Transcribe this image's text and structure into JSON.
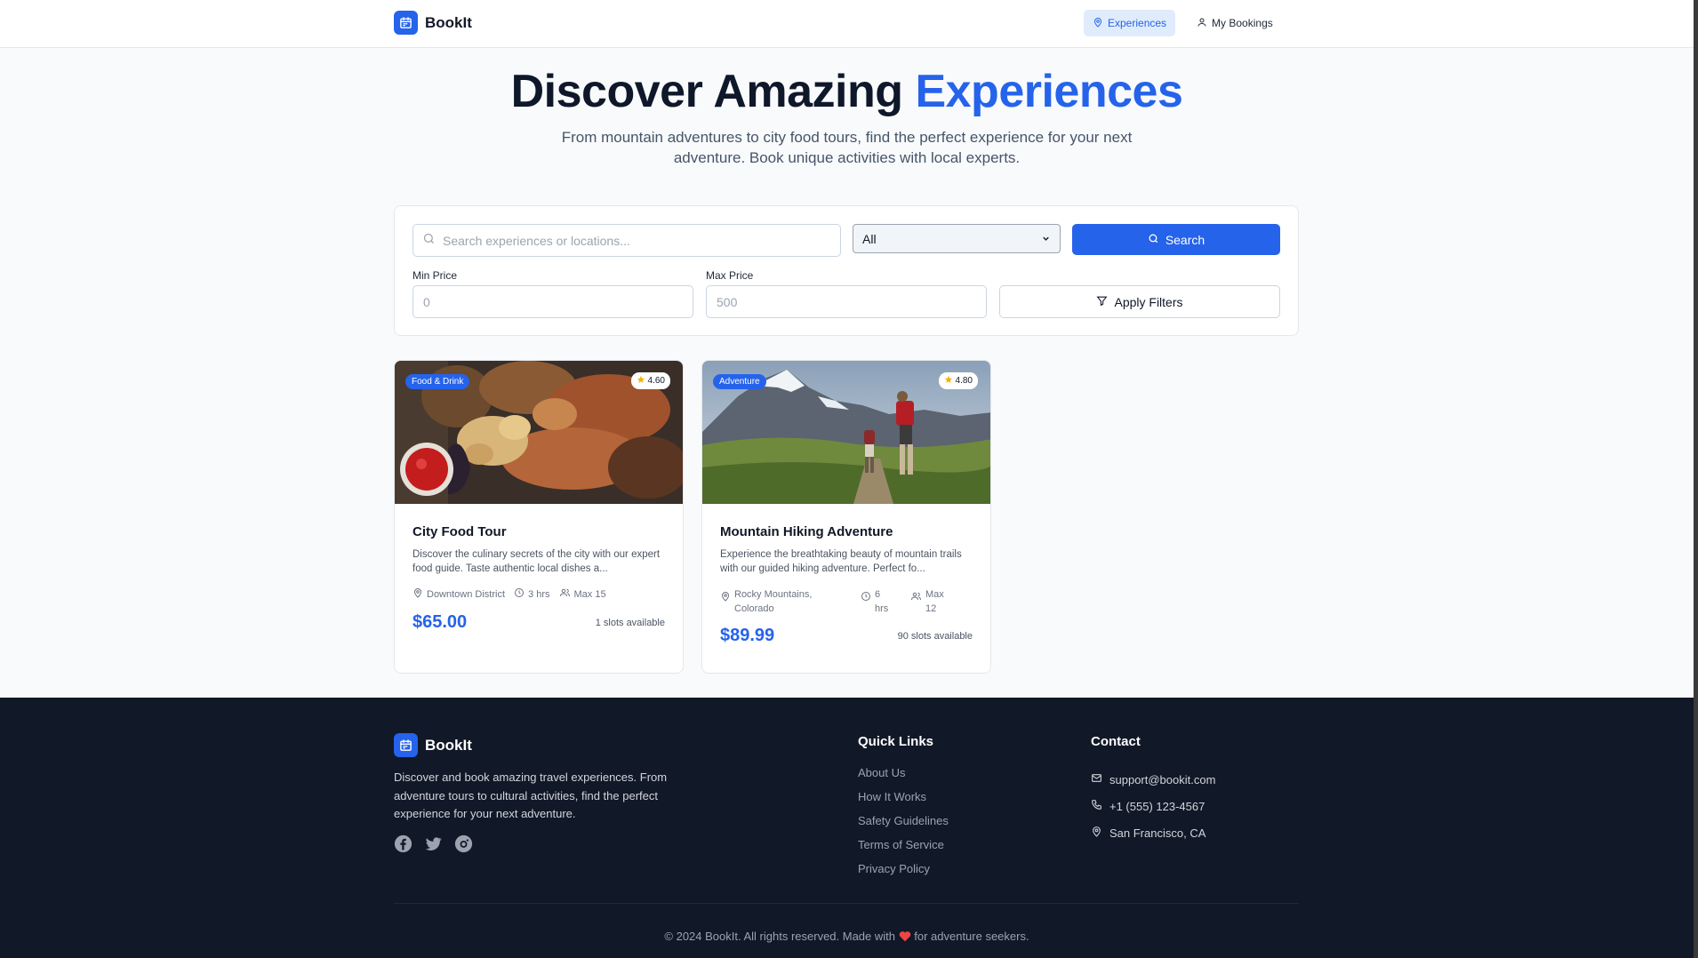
{
  "header": {
    "brand": "BookIt",
    "nav": [
      {
        "label": "Experiences",
        "icon": "map-pin-icon",
        "active": true
      },
      {
        "label": "My Bookings",
        "icon": "user-icon",
        "active": false
      }
    ]
  },
  "hero": {
    "title_main": "Discover Amazing ",
    "title_accent": "Experiences",
    "subtitle": "From mountain adventures to city food tours, find the perfect experience for your next adventure. Book unique activities with local experts."
  },
  "filters": {
    "search_placeholder": "Search experiences or locations...",
    "search_value": "",
    "category_selected": "All",
    "search_button": "Search",
    "min_label": "Min Price",
    "min_placeholder": "0",
    "max_label": "Max Price",
    "max_placeholder": "500",
    "apply_button": "Apply Filters"
  },
  "experiences": [
    {
      "category": "Food & Drink",
      "rating": "4.60",
      "title": "City Food Tour",
      "description": "Discover the culinary secrets of the city with our expert food guide. Taste authentic local dishes a...",
      "location": "Downtown District",
      "duration": "3 hrs",
      "capacity": "Max 15",
      "price": "$65.00",
      "slots": "1 slots available"
    },
    {
      "category": "Adventure",
      "rating": "4.80",
      "title": "Mountain Hiking Adventure",
      "description": "Experience the breathtaking beauty of mountain trails with our guided hiking adventure. Perfect fo...",
      "location": "Rocky Mountains, Colorado",
      "duration": "6 hrs",
      "capacity": "Max 12",
      "price": "$89.99",
      "slots": "90 slots available"
    }
  ],
  "footer": {
    "brand": "BookIt",
    "description": "Discover and book amazing travel experiences. From adventure tours to cultural activities, find the perfect experience for your next adventure.",
    "socials": [
      "facebook-icon",
      "twitter-icon",
      "instagram-icon"
    ],
    "quick_links_title": "Quick Links",
    "quick_links": [
      "About Us",
      "How It Works",
      "Safety Guidelines",
      "Terms of Service",
      "Privacy Policy"
    ],
    "contact_title": "Contact",
    "contact": {
      "email": "support@bookit.com",
      "phone": "+1 (555) 123-4567",
      "location": "San Francisco, CA"
    },
    "copyright_before": "© 2024 BookIt. All rights reserved. Made with ",
    "copyright_after": " for adventure seekers."
  },
  "colors": {
    "accent": "#2563eb",
    "footer_bg": "#111827",
    "page_bg": "#f8fafc"
  }
}
